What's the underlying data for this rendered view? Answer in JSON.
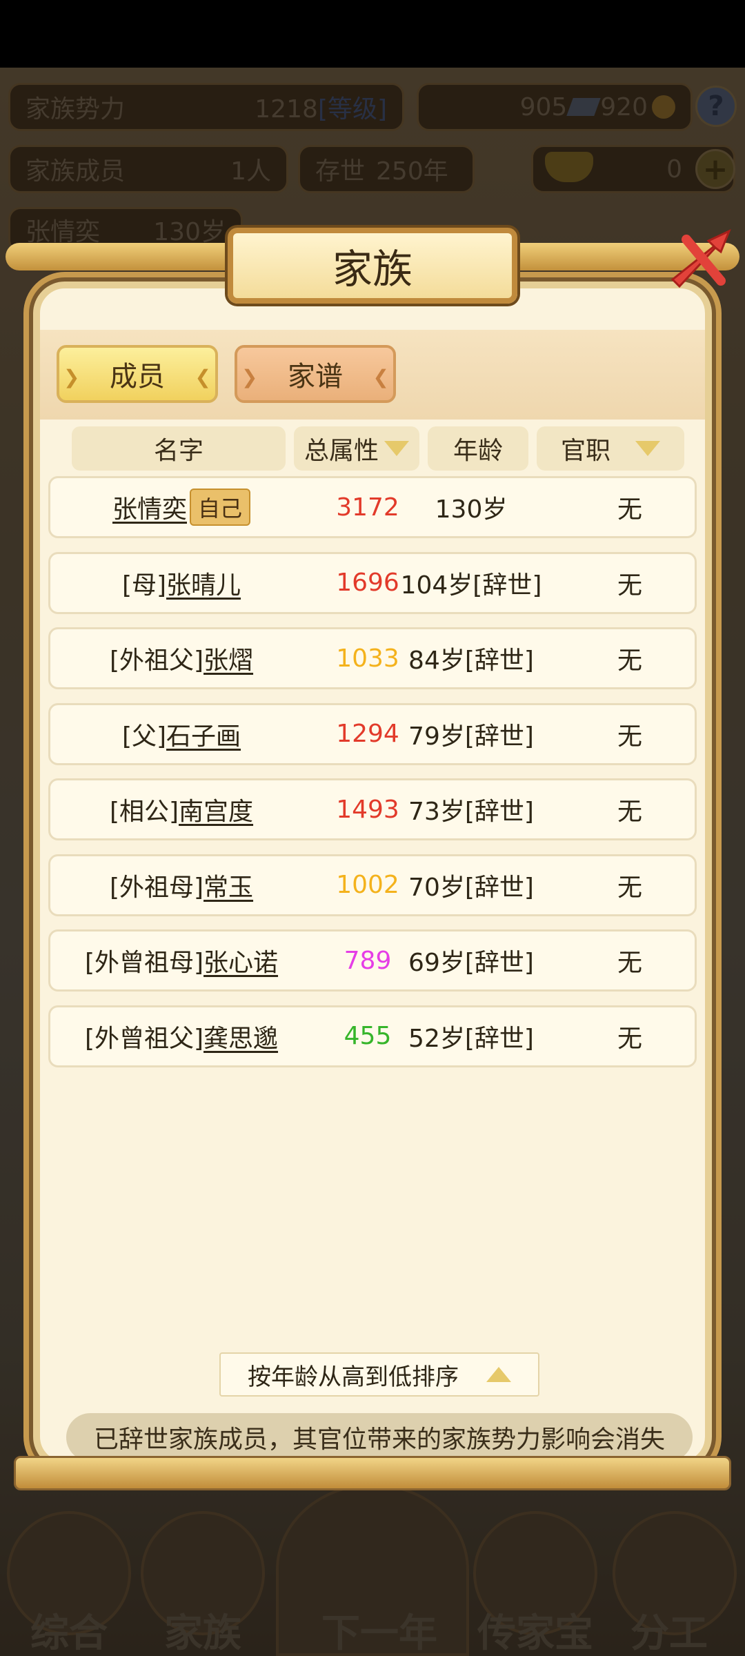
{
  "background": {
    "family_power_label": "家族势力",
    "family_power_value": "1218",
    "family_power_tag": "[等级]",
    "silver_value": "905",
    "coin_value": "920",
    "members_label": "家族成员",
    "members_value": "1人",
    "existence_label": "存世",
    "existence_value": "250年",
    "gold_value": "0",
    "current_member_name": "张情奕",
    "current_member_age": "130岁",
    "nav": [
      "综合",
      "家族",
      "下一年",
      "传家宝",
      "分工"
    ]
  },
  "dialog": {
    "title": "家族",
    "tabs": {
      "active": "成员",
      "inactive": "家谱"
    },
    "columns": {
      "name": "名字",
      "attr": "总属性",
      "age": "年龄",
      "office": "官职"
    },
    "self_badge": "自己",
    "rows": [
      {
        "prefix": "",
        "name": "张情奕",
        "attr": "3172",
        "attr_color": "#e23a2a",
        "age": "130岁",
        "office": "无",
        "self": true
      },
      {
        "prefix": "[母]",
        "name": "张晴儿",
        "attr": "1696",
        "attr_color": "#e23a2a",
        "age": "104岁[辞世]",
        "office": "无"
      },
      {
        "prefix": "[外祖父]",
        "name": "张熠",
        "attr": "1033",
        "attr_color": "#f4b21c",
        "age": "84岁[辞世]",
        "office": "无"
      },
      {
        "prefix": "[父]",
        "name": "石子画",
        "attr": "1294",
        "attr_color": "#e23a2a",
        "age": "79岁[辞世]",
        "office": "无"
      },
      {
        "prefix": "[相公]",
        "name": "南宫度",
        "attr": "1493",
        "attr_color": "#e23a2a",
        "age": "73岁[辞世]",
        "office": "无"
      },
      {
        "prefix": "[外祖母]",
        "name": "常玉",
        "attr": "1002",
        "attr_color": "#f4b21c",
        "age": "70岁[辞世]",
        "office": "无"
      },
      {
        "prefix": "[外曾祖母]",
        "name": "张心诺",
        "attr": "789",
        "attr_color": "#e53de6",
        "age": "69岁[辞世]",
        "office": "无"
      },
      {
        "prefix": "[外曾祖父]",
        "name": "龚思邈",
        "attr": "455",
        "attr_color": "#36b52a",
        "age": "52岁[辞世]",
        "office": "无"
      }
    ],
    "sort_label": "按年龄从高到低排序",
    "notice": "已辞世家族成员，其官位带来的家族势力影响会消失"
  }
}
